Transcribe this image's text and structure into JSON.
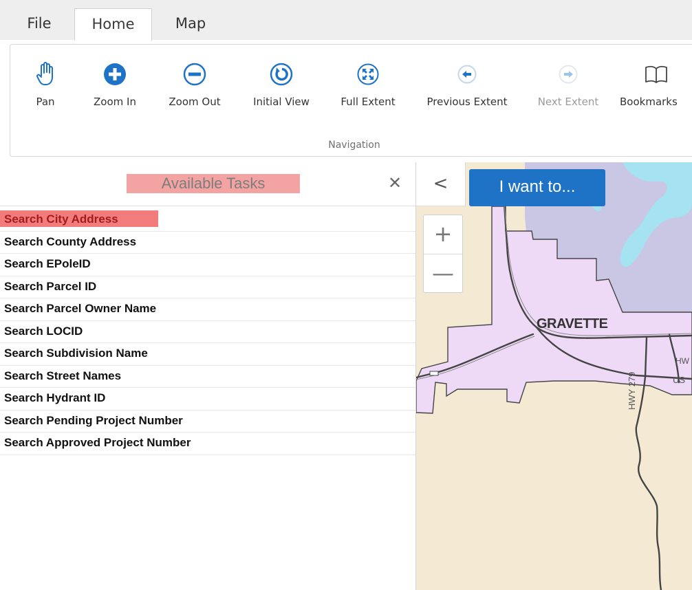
{
  "ribbon": {
    "tabs": [
      {
        "label": "File"
      },
      {
        "label": "Home"
      },
      {
        "label": "Map"
      }
    ],
    "tools": [
      {
        "label": "Pan",
        "icon": "hand-icon"
      },
      {
        "label": "Zoom In",
        "icon": "zoom-in-icon"
      },
      {
        "label": "Zoom Out",
        "icon": "zoom-out-icon"
      },
      {
        "label": "Initial View",
        "icon": "initial-view-icon"
      },
      {
        "label": "Full Extent",
        "icon": "full-extent-icon"
      },
      {
        "label": "Previous Extent",
        "icon": "previous-extent-icon"
      },
      {
        "label": "Next Extent",
        "icon": "next-extent-icon",
        "disabled": true
      },
      {
        "label": "Bookmarks",
        "icon": "bookmarks-icon"
      }
    ],
    "group_label": "Navigation"
  },
  "panel": {
    "title": "Available Tasks",
    "close_glyph": "✕",
    "tasks": [
      "Search City Address",
      "Search County Address",
      "Search EPoleID",
      "Search Parcel ID",
      "Search Parcel Owner Name",
      "Search LOCID",
      "Search Subdivision Name",
      "Search Street Names",
      "Search Hydrant ID",
      "Search Pending Project Number",
      "Search Approved Project Number"
    ]
  },
  "map": {
    "toggle_glyph": "<",
    "i_want_to": "I want to...",
    "zoom_in_glyph": "+",
    "zoom_out_glyph": "—",
    "labels": {
      "city": "GRAVETTE",
      "hwy": "HWY 279",
      "us": "US",
      "hm": "HW"
    }
  },
  "colors": {
    "accent_blue": "#1f73c7",
    "highlight_red": "#f27c7c",
    "title_highlight": "#f4a3a3",
    "city_fill": "#eed9f6",
    "water": "#a6e3f2",
    "land": "#f4ead4",
    "icon_blue": "#1f73c7"
  }
}
